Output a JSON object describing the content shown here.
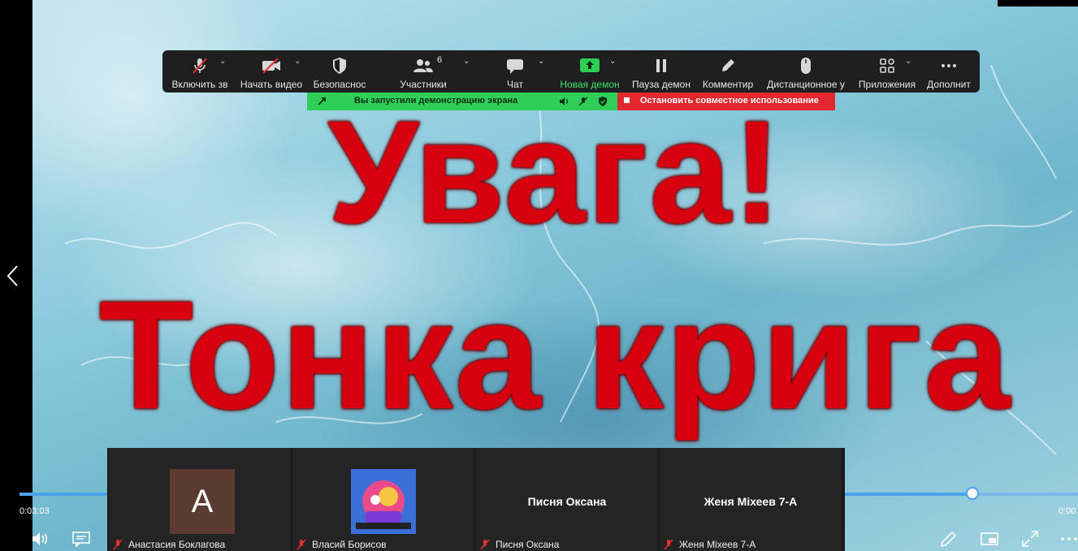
{
  "slide": {
    "line1": "Увага!",
    "line2": "Тонка крига"
  },
  "toolbar": {
    "mute_label": "Включить зв",
    "video_label": "Начать видео",
    "security_label": "Безопаснос",
    "participants_label": "Участники",
    "participants_count": "6",
    "chat_label": "Чат",
    "new_share_label": "Новая демон",
    "pause_share_label": "Пауза демон",
    "annotate_label": "Комментир",
    "remote_label": "Дистанционное у",
    "apps_label": "Приложения",
    "more_label": "Дополнит"
  },
  "share_status": {
    "message": "Вы запустили демонстрацию экрана",
    "stop_label": "Остановить совместное использование"
  },
  "player": {
    "current_time": "0:03:03",
    "end_time": "0:00",
    "progress": 0.9
  },
  "participants": [
    {
      "initial": "A",
      "name": "Анастасия Боклагова"
    },
    {
      "name": "Власий Борисов"
    },
    {
      "center_name": "Писня Оксана",
      "name": "Писня Оксана"
    },
    {
      "center_name": "Женя Міхеев 7-А",
      "name": "Женя Міхеев 7-А"
    }
  ],
  "colors": {
    "toolbar_bg": "#1f1f1f",
    "share_green": "#2fcf57",
    "stop_red": "#e0282e",
    "accent_blue": "#4aa3e8",
    "slide_text_red": "#d6000f"
  },
  "icons": [
    "mic-muted-icon",
    "video-off-icon",
    "shield-icon",
    "people-icon",
    "chat-icon",
    "share-up-icon",
    "pause-icon",
    "pen-icon",
    "mouse-icon",
    "apps-icon",
    "more-icon",
    "volume-icon",
    "captions-icon",
    "pencil-icon",
    "pip-icon",
    "fullscreen-icon",
    "more-dots-icon",
    "left-arrow-icon"
  ]
}
